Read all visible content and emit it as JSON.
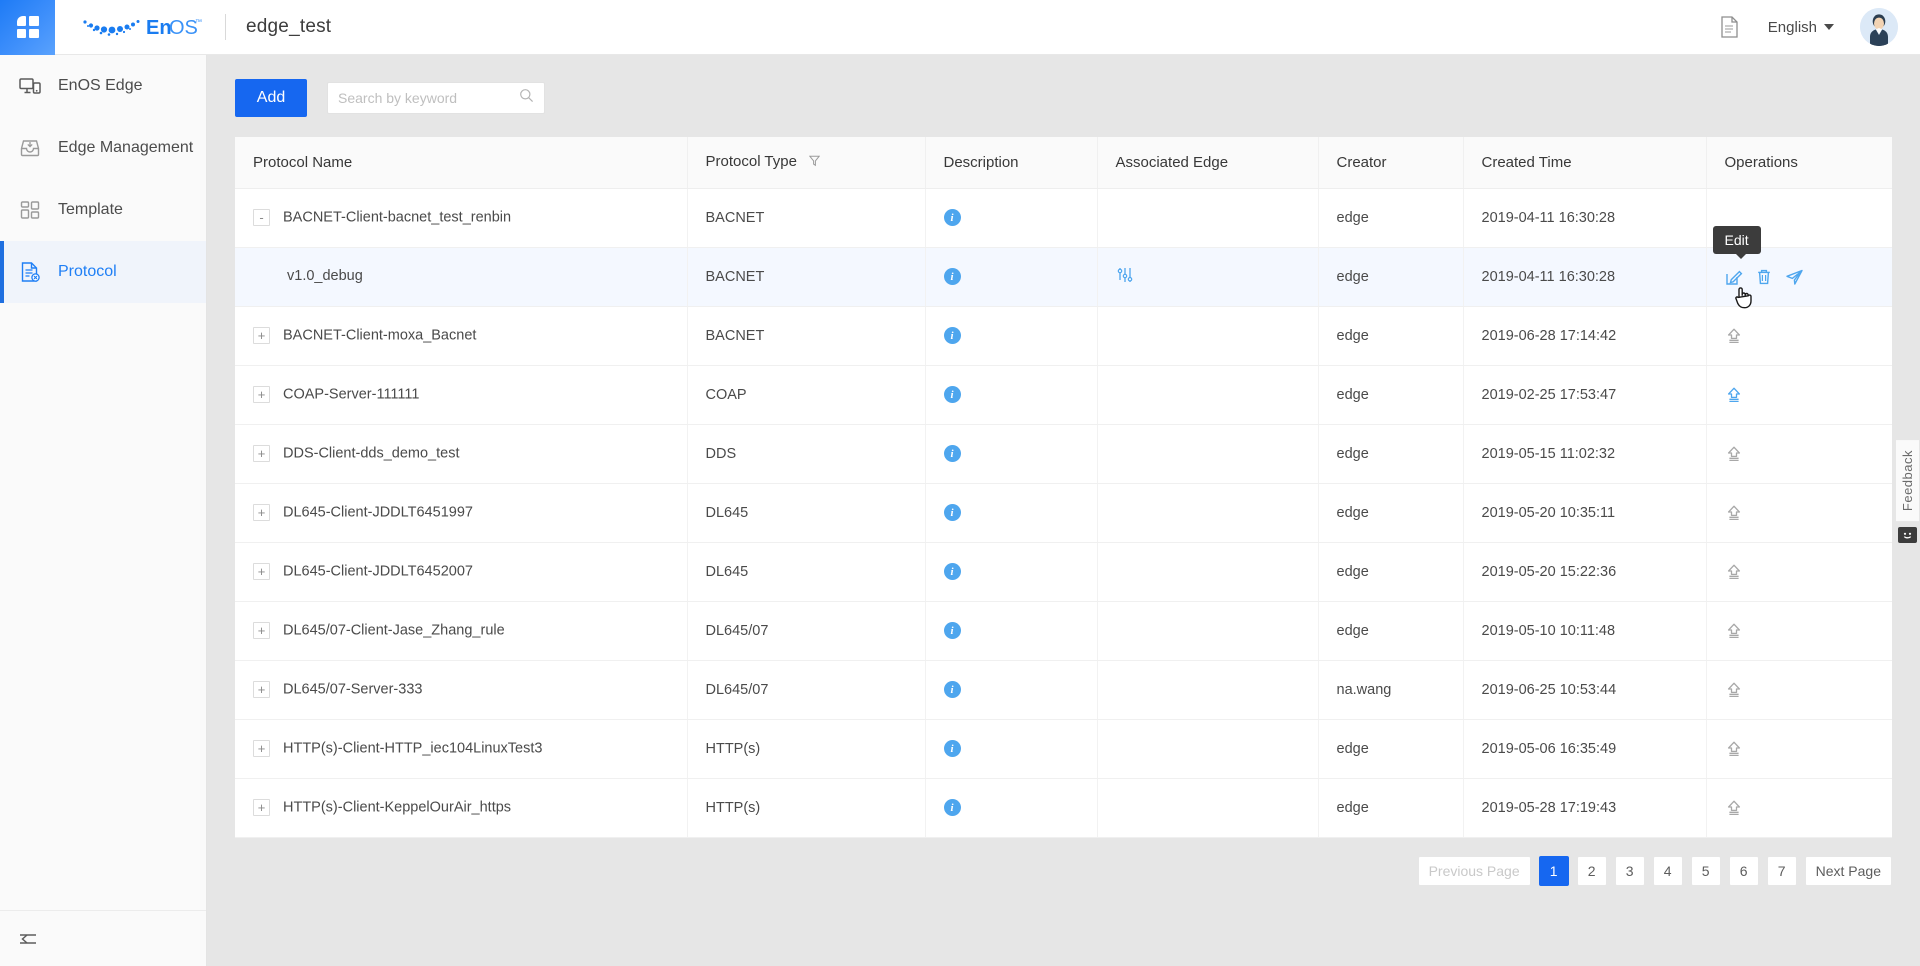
{
  "header": {
    "apps_icon": "apps-grid-icon",
    "brand": "EnOS",
    "brand_tm": "™",
    "page_title": "edge_test",
    "doc_icon": "document-icon",
    "language": "English",
    "avatar": "user-avatar"
  },
  "sidebar": {
    "items": [
      {
        "label": "EnOS Edge",
        "icon": "monitor-device-icon",
        "active": false
      },
      {
        "label": "Edge Management",
        "icon": "inbox-download-icon",
        "active": false
      },
      {
        "label": "Template",
        "icon": "grid-blocks-icon",
        "active": false
      },
      {
        "label": "Protocol",
        "icon": "document-gear-icon",
        "active": true
      }
    ],
    "collapse_icon": "collapse-left-icon"
  },
  "toolbar": {
    "add_label": "Add",
    "search_placeholder": "Search by keyword",
    "search_value": "",
    "search_icon": "search-icon"
  },
  "table": {
    "columns": [
      {
        "label": "Protocol Name",
        "filter": false
      },
      {
        "label": "Protocol Type",
        "filter": true,
        "filter_icon": "filter-funnel-icon"
      },
      {
        "label": "Description",
        "filter": false
      },
      {
        "label": "Associated Edge",
        "filter": false
      },
      {
        "label": "Creator",
        "filter": false
      },
      {
        "label": "Created Time",
        "filter": false
      },
      {
        "label": "Operations",
        "filter": false
      }
    ],
    "rows": [
      {
        "expander": "-",
        "child": false,
        "hovered": false,
        "name": "BACNET-Client-bacnet_test_renbin",
        "type": "BACNET",
        "description_icon": "info-icon",
        "associated_edge_icon": "",
        "creator": "edge",
        "created_time": "2019-04-11 16:30:28",
        "ops": []
      },
      {
        "expander": "",
        "child": true,
        "hovered": true,
        "name": "v1.0_debug",
        "type": "BACNET",
        "description_icon": "info-icon",
        "associated_edge_icon": "sliders-icon",
        "creator": "edge",
        "created_time": "2019-04-11 16:30:28",
        "ops": [
          "edit-icon",
          "delete-icon",
          "send-icon"
        ]
      },
      {
        "expander": "+",
        "child": false,
        "hovered": false,
        "name": "BACNET-Client-moxa_Bacnet",
        "type": "BACNET",
        "description_icon": "info-icon",
        "associated_edge_icon": "",
        "creator": "edge",
        "created_time": "2019-06-28 17:14:42",
        "ops": [
          "upload-icon-gray"
        ]
      },
      {
        "expander": "+",
        "child": false,
        "hovered": false,
        "name": "COAP-Server-111111",
        "type": "COAP",
        "description_icon": "info-icon",
        "associated_edge_icon": "",
        "creator": "edge",
        "created_time": "2019-02-25 17:53:47",
        "ops": [
          "upload-icon-blue"
        ]
      },
      {
        "expander": "+",
        "child": false,
        "hovered": false,
        "name": "DDS-Client-dds_demo_test",
        "type": "DDS",
        "description_icon": "info-icon",
        "associated_edge_icon": "",
        "creator": "edge",
        "created_time": "2019-05-15 11:02:32",
        "ops": [
          "upload-icon-gray"
        ]
      },
      {
        "expander": "+",
        "child": false,
        "hovered": false,
        "name": "DL645-Client-JDDLT6451997",
        "type": "DL645",
        "description_icon": "info-icon",
        "associated_edge_icon": "",
        "creator": "edge",
        "created_time": "2019-05-20 10:35:11",
        "ops": [
          "upload-icon-gray"
        ]
      },
      {
        "expander": "+",
        "child": false,
        "hovered": false,
        "name": "DL645-Client-JDDLT6452007",
        "type": "DL645",
        "description_icon": "info-icon",
        "associated_edge_icon": "",
        "creator": "edge",
        "created_time": "2019-05-20 15:22:36",
        "ops": [
          "upload-icon-gray"
        ]
      },
      {
        "expander": "+",
        "child": false,
        "hovered": false,
        "name": "DL645/07-Client-Jase_Zhang_rule",
        "type": "DL645/07",
        "description_icon": "info-icon",
        "associated_edge_icon": "",
        "creator": "edge",
        "created_time": "2019-05-10 10:11:48",
        "ops": [
          "upload-icon-gray"
        ]
      },
      {
        "expander": "+",
        "child": false,
        "hovered": false,
        "name": "DL645/07-Server-333",
        "type": "DL645/07",
        "description_icon": "info-icon",
        "associated_edge_icon": "",
        "creator": "na.wang",
        "created_time": "2019-06-25 10:53:44",
        "ops": [
          "upload-icon-gray"
        ]
      },
      {
        "expander": "+",
        "child": false,
        "hovered": false,
        "name": "HTTP(s)-Client-HTTP_iec104LinuxTest3",
        "type": "HTTP(s)",
        "description_icon": "info-icon",
        "associated_edge_icon": "",
        "creator": "edge",
        "created_time": "2019-05-06 16:35:49",
        "ops": [
          "upload-icon-gray"
        ]
      },
      {
        "expander": "+",
        "child": false,
        "hovered": false,
        "name": "HTTP(s)-Client-KeppelOurAir_https",
        "type": "HTTP(s)",
        "description_icon": "info-icon",
        "associated_edge_icon": "",
        "creator": "edge",
        "created_time": "2019-05-28 17:19:43",
        "ops": [
          "upload-icon-gray"
        ]
      }
    ]
  },
  "tooltip": {
    "text": "Edit"
  },
  "pagination": {
    "previous_label": "Previous Page",
    "next_label": "Next Page",
    "pages": [
      "1",
      "2",
      "3",
      "4",
      "5",
      "6",
      "7"
    ],
    "current": "1"
  },
  "feedback": {
    "label": "Feedback",
    "icon": "smiley-face-icon"
  },
  "colors": {
    "accent_blue": "#1667f0",
    "icon_blue": "#4ea6ee",
    "sidebar_active_bg": "#f0f4fb",
    "row_hover_bg": "#f4f8ff",
    "page_bg": "#e6e6e6"
  }
}
